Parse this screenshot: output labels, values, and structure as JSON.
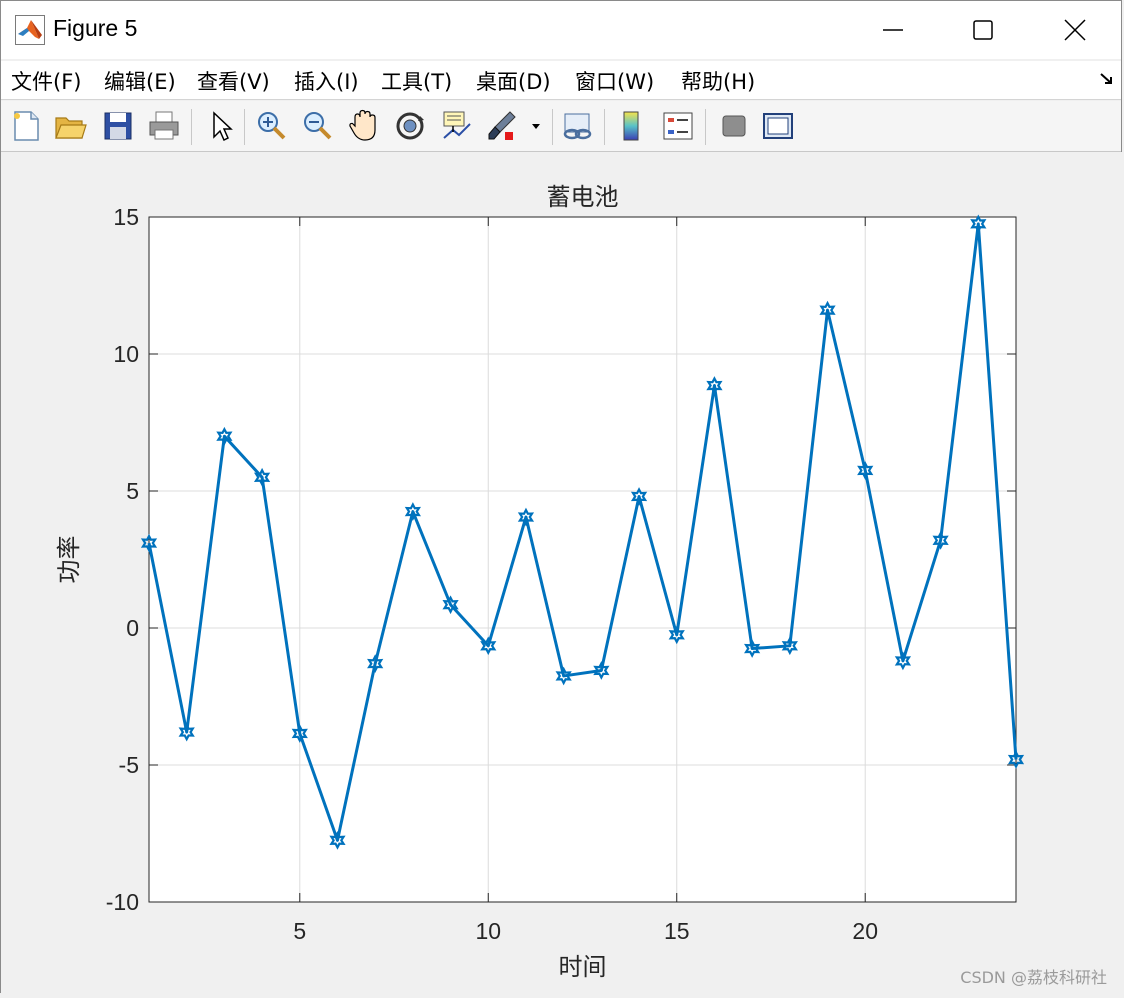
{
  "window": {
    "title": "Figure 5",
    "controls": [
      "minimize",
      "maximize",
      "close"
    ]
  },
  "menubar": {
    "items": [
      {
        "label": "文件(F)"
      },
      {
        "label": "编辑(E)"
      },
      {
        "label": "查看(V)"
      },
      {
        "label": "插入(I)"
      },
      {
        "label": "工具(T)"
      },
      {
        "label": "桌面(D)"
      },
      {
        "label": "窗口(W)"
      },
      {
        "label": "帮助(H)"
      }
    ]
  },
  "toolbar": {
    "tools": [
      {
        "icon": "new-figure-icon"
      },
      {
        "icon": "open-file-icon"
      },
      {
        "icon": "save-icon"
      },
      {
        "icon": "print-icon"
      },
      {
        "icon": "edit-plot-pointer-icon"
      },
      {
        "icon": "zoom-in-icon"
      },
      {
        "icon": "zoom-out-icon"
      },
      {
        "icon": "pan-hand-icon"
      },
      {
        "icon": "rotate-3d-icon"
      },
      {
        "icon": "data-cursor-icon"
      },
      {
        "icon": "brush-icon"
      },
      {
        "icon": "brush-dropdown-icon"
      },
      {
        "icon": "link-plot-icon"
      },
      {
        "icon": "insert-colorbar-icon"
      },
      {
        "icon": "insert-legend-icon"
      },
      {
        "icon": "hide-plot-tools-icon"
      },
      {
        "icon": "show-plot-tools-icon"
      }
    ]
  },
  "chart_data": {
    "type": "line",
    "title": "蓄电池",
    "xlabel": "时间",
    "ylabel": "功率",
    "xlim": [
      1,
      24
    ],
    "ylim": [
      -10,
      15
    ],
    "xticks": [
      5,
      10,
      15,
      20
    ],
    "yticks": [
      -10,
      -5,
      0,
      5,
      10,
      15
    ],
    "grid": true,
    "marker": "hexagram",
    "color": "#0072BD",
    "x": [
      1,
      2,
      3,
      4,
      5,
      6,
      7,
      8,
      9,
      10,
      11,
      12,
      13,
      14,
      15,
      16,
      17,
      18,
      19,
      20,
      21,
      22,
      23,
      24
    ],
    "series": [
      {
        "values": [
          3.1,
          -3.8,
          7.0,
          5.5,
          -3.85,
          -7.75,
          -1.3,
          4.25,
          0.85,
          -0.65,
          4.05,
          -1.75,
          -1.55,
          4.8,
          -0.25,
          8.85,
          -0.75,
          -0.65,
          11.6,
          5.75,
          -1.2,
          3.2,
          14.75,
          -4.8
        ]
      }
    ]
  },
  "watermark": "CSDN @荔枝科研社"
}
